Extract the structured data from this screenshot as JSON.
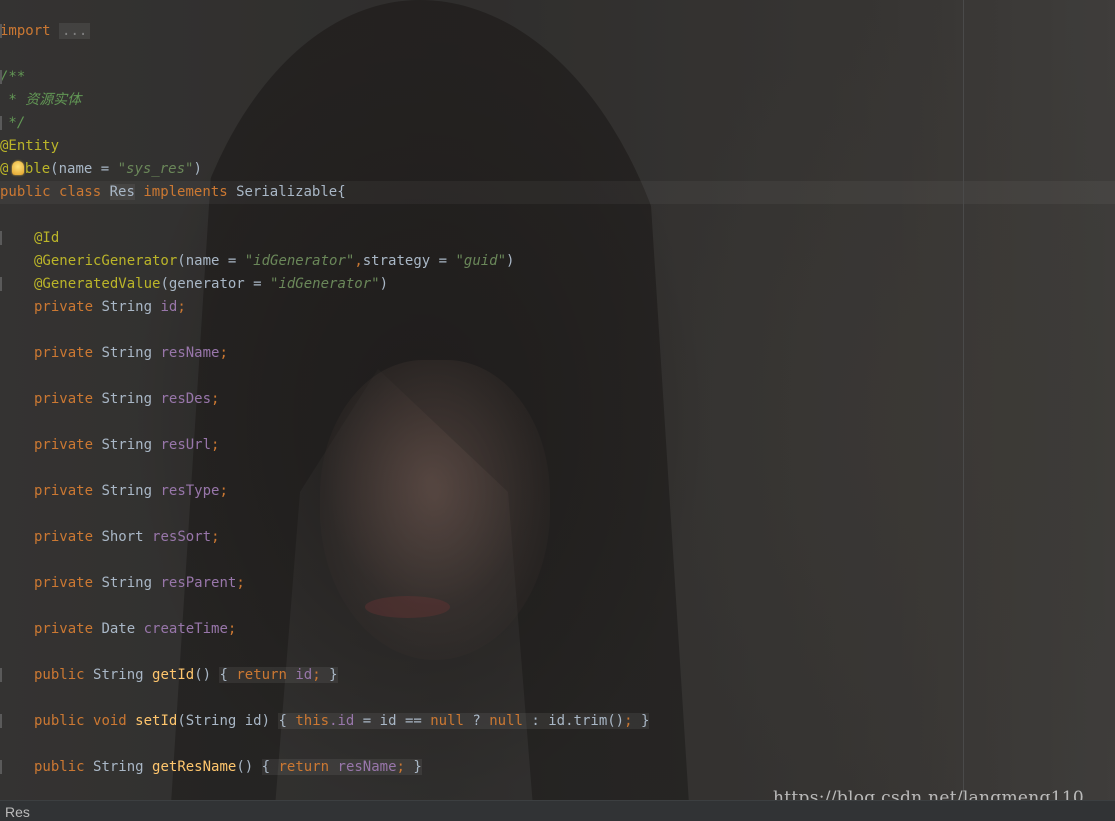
{
  "editor": {
    "file_breadcrumb": "Res",
    "watermark": "https://blog.csdn.net/langmeng110",
    "colors": {
      "background": "#2b2b2b",
      "keyword": "#cc7832",
      "annotation": "#bbb529",
      "string": "#6a8759",
      "comment": "#629755",
      "field": "#9876aa",
      "method": "#ffc66d",
      "text": "#a9b7c6"
    }
  },
  "code": {
    "l1": {
      "kw": "import",
      "fold": "..."
    },
    "l2": {
      "cmt": "/**"
    },
    "l3": {
      "cmt": " * 资源实体"
    },
    "l4": {
      "cmt": " */"
    },
    "l5": {
      "ann": "@Entity"
    },
    "l6": {
      "ann_a": "@",
      "ann_b": "able",
      "p1": "(name = ",
      "s1": "\"sys_res\"",
      "p2": ")"
    },
    "l7": {
      "k1": "public",
      "k2": "class",
      "cls": "Res",
      "k3": "implements",
      "t": "Serializable{"
    },
    "l8": {
      "ann": "@Id"
    },
    "l9": {
      "ann": "@GenericGenerator",
      "p1": "(name = ",
      "s1": "\"idGenerator\"",
      "c": ",",
      "p2": "strategy = ",
      "s2": "\"guid\"",
      "p3": ")"
    },
    "l10": {
      "ann": "@GeneratedValue",
      "p1": "(generator = ",
      "s1": "\"idGenerator\"",
      "p2": ")"
    },
    "fields": [
      {
        "type": "String",
        "name": "id"
      },
      {
        "type": "String",
        "name": "resName"
      },
      {
        "type": "String",
        "name": "resDes"
      },
      {
        "type": "String",
        "name": "resUrl"
      },
      {
        "type": "String",
        "name": "resType"
      },
      {
        "type": "Short",
        "name": "resSort"
      },
      {
        "type": "String",
        "name": "resParent"
      },
      {
        "type": "Date",
        "name": "createTime"
      }
    ],
    "private_kw": "private",
    "semicolon": ";",
    "m1": {
      "k": "public",
      "t": "String",
      "name": "getId",
      "parens": "()",
      "open": "{",
      "ret": "return",
      "fld": "id",
      "close": "}"
    },
    "m2": {
      "k": "public",
      "t": "void",
      "name": "setId",
      "sig": "(String id)",
      "open": "{",
      "this": "this",
      "dotid": ".id",
      "mid": " = id == ",
      "null1": "null",
      "q": " ? ",
      "null2": "null",
      "tail": " : id.trim()",
      "close": "}"
    },
    "m3": {
      "k": "public",
      "t": "String",
      "name": "getResName",
      "parens": "()",
      "open": "{",
      "ret": "return",
      "fld": "resName",
      "close": "}"
    }
  }
}
